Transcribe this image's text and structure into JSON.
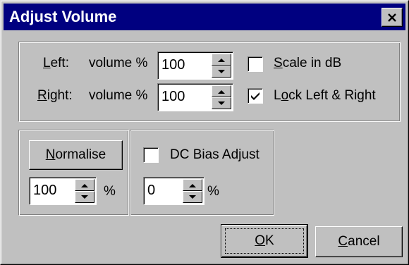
{
  "window": {
    "title": "Adjust Volume"
  },
  "channels": {
    "left": {
      "label_accel": "L",
      "label_rest": "eft:",
      "volume_label": "volume %",
      "value": "100"
    },
    "right": {
      "label_accel": "R",
      "label_rest": "ight:",
      "volume_label": "volume %",
      "value": "100"
    }
  },
  "options": {
    "scale_db": {
      "accel": "S",
      "rest": "cale in dB",
      "checked": false
    },
    "lock_lr": {
      "pre": "L",
      "accel": "o",
      "rest": "ck Left & Right",
      "checked": true
    }
  },
  "normalise": {
    "button_accel": "N",
    "button_rest": "ormalise",
    "value": "100",
    "unit": "%"
  },
  "dc_bias": {
    "label": "DC Bias Adjust",
    "checked": false,
    "value": "0",
    "unit": "%"
  },
  "buttons": {
    "ok": {
      "accel": "O",
      "rest": "K"
    },
    "cancel": {
      "accel": "C",
      "rest": "ancel"
    }
  }
}
